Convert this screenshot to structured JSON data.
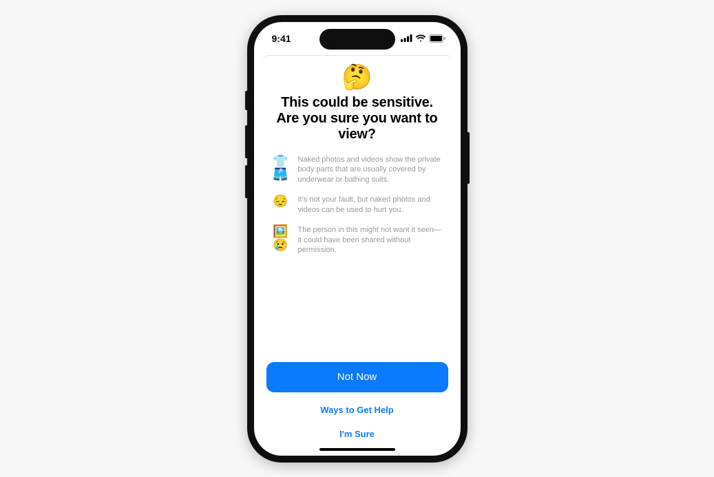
{
  "status": {
    "time": "9:41"
  },
  "dialog": {
    "hero_emoji": "🤔",
    "title_line1": "This could be sensitive.",
    "title_line2": "Are you sure you want to view?",
    "bullets": [
      {
        "icon": "👕🩳",
        "text": "Naked photos and videos show the private body parts that are usually covered by underwear or bathing suits."
      },
      {
        "icon": "😔",
        "text": "It's not your fault, but naked photos and videos can be used to hurt you."
      },
      {
        "icon": "🖼️😢",
        "text": "The person in this might not want it seen—it could have been shared without permission."
      }
    ],
    "actions": {
      "primary": "Not Now",
      "help": "Ways to Get Help",
      "confirm": "I'm Sure"
    }
  }
}
